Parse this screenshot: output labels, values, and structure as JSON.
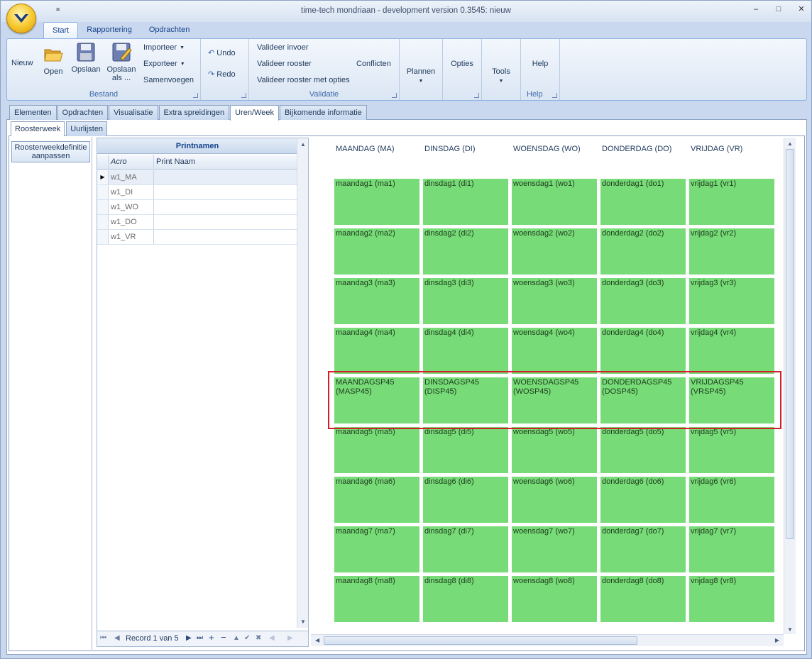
{
  "window": {
    "title": "time-tech mondriaan - development version 0.3545: nieuw",
    "quick_access": "≡"
  },
  "ribbon_tabs": [
    "Start",
    "Rapportering",
    "Opdrachten"
  ],
  "ribbon": {
    "bestand": {
      "label": "Bestand",
      "nieuw": "Nieuw",
      "open": "Open",
      "opslaan": "Opslaan",
      "opslaan_als_1": "Opslaan",
      "opslaan_als_2": "als ...",
      "importeer": "Importeer",
      "exporteer": "Exporteer",
      "samenvoegen": "Samenvoegen"
    },
    "undo": "Undo",
    "redo": "Redo",
    "validatie": {
      "label": "Validatie",
      "valideer_invoer": "Valideer invoer",
      "valideer_rooster": "Valideer rooster",
      "valideer_rooster_opties": "Valideer rooster met opties",
      "conflicten": "Conflicten"
    },
    "plannen": "Plannen",
    "opties": "Opties",
    "tools": "Tools",
    "help_btn": "Help",
    "help_label": "Help"
  },
  "doc_tabs": [
    "Elementen",
    "Opdrachten",
    "Visualisatie",
    "Extra spreidingen",
    "Uren/Week",
    "Bijkomende informatie"
  ],
  "sub_tabs": [
    "Roosterweek",
    "Uurlijsten"
  ],
  "left_panel": {
    "button_line1": "Roosterweekdefinitie",
    "button_line2": "aanpassen"
  },
  "grid": {
    "title": "Printnamen",
    "columns": [
      "Acro",
      "Print Naam"
    ],
    "rows": [
      {
        "acro": "w1_MA",
        "print_naam": ""
      },
      {
        "acro": "w1_DI",
        "print_naam": ""
      },
      {
        "acro": "w1_WO",
        "print_naam": ""
      },
      {
        "acro": "w1_DO",
        "print_naam": ""
      },
      {
        "acro": "w1_VR",
        "print_naam": ""
      }
    ],
    "selected_row_marker": "▶",
    "navigator": {
      "record_text": "Record 1 van 5",
      "first": "⏮",
      "prev": "◀",
      "next": "▶",
      "last": "⏭",
      "add": "+",
      "remove": "−",
      "up": "▲",
      "check": "✔",
      "cancel": "✖",
      "prev_page": "◀",
      "next_page": "▶"
    }
  },
  "schedule": {
    "days": [
      "MAANDAG (MA)",
      "DINSDAG (DI)",
      "WOENSDAG (WO)",
      "DONDERDAG (DO)",
      "VRIJDAG (VR)"
    ],
    "rows": [
      [
        "maandag1 (ma1)",
        "dinsdag1 (di1)",
        "woensdag1 (wo1)",
        "donderdag1 (do1)",
        "vrijdag1 (vr1)"
      ],
      [
        "maandag2 (ma2)",
        "dinsdag2 (di2)",
        "woensdag2 (wo2)",
        "donderdag2 (do2)",
        "vrijdag2 (vr2)"
      ],
      [
        "maandag3 (ma3)",
        "dinsdag3 (di3)",
        "woensdag3 (wo3)",
        "donderdag3 (do3)",
        "vrijdag3 (vr3)"
      ],
      [
        "maandag4 (ma4)",
        "dinsdag4 (di4)",
        "woensdag4 (wo4)",
        "donderdag4 (do4)",
        "vrijdag4 (vr4)"
      ],
      [
        "MAANDAGSP45 (MASP45)",
        "DINSDAGSP45 (DISP45)",
        "WOENSDAGSP45 (WOSP45)",
        "DONDERDAGSP45 (DOSP45)",
        "VRIJDAGSP45 (VRSP45)"
      ],
      [
        "maandag5 (ma5)",
        "dinsdag5 (di5)",
        "woensdag5 (wo5)",
        "donderdag5 (do5)",
        "vrijdag5 (vr5)"
      ],
      [
        "maandag6 (ma6)",
        "dinsdag6 (di6)",
        "woensdag6 (wo6)",
        "donderdag6 (do6)",
        "vrijdag6 (vr6)"
      ],
      [
        "maandag7 (ma7)",
        "dinsdag7 (di7)",
        "woensdag7 (wo7)",
        "donderdag7 (do7)",
        "vrijdag7 (vr7)"
      ],
      [
        "maandag8 (ma8)",
        "dinsdag8 (di8)",
        "woensdag8 (wo8)",
        "donderdag8 (do8)",
        "vrijdag8 (vr8)"
      ]
    ],
    "highlighted_row": 4,
    "cell_color": "#77dc77",
    "highlight_color": "#d61e2a"
  }
}
